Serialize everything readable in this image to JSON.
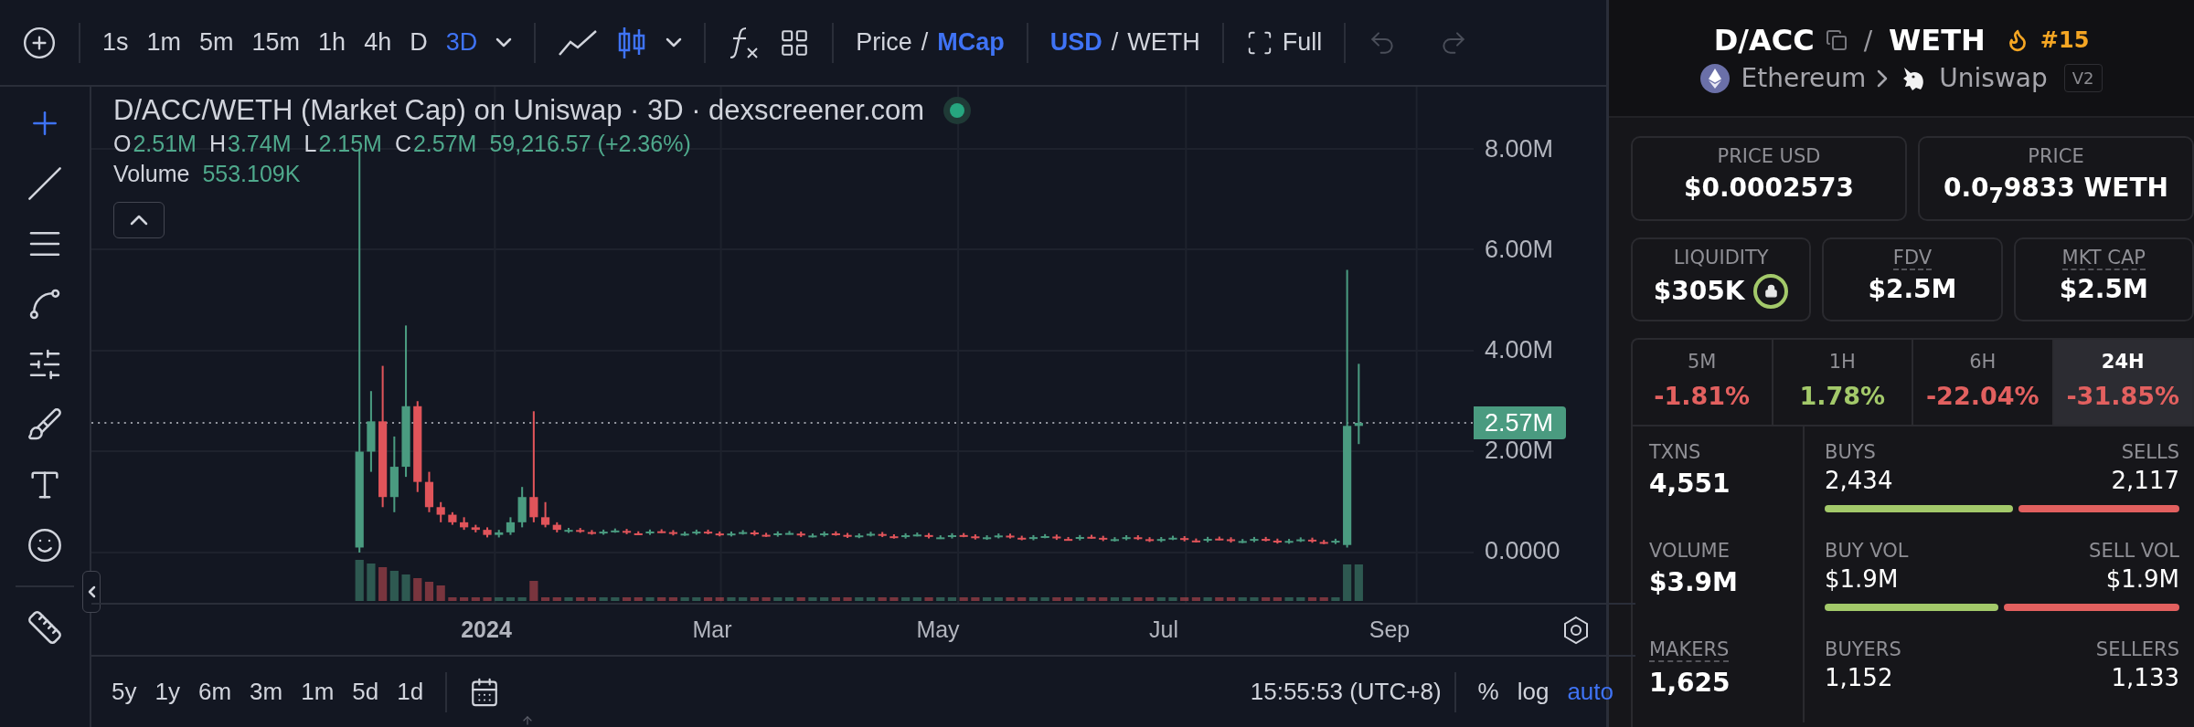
{
  "toolbar": {
    "intervals": [
      {
        "label": "1s",
        "selected": false
      },
      {
        "label": "1m",
        "selected": false
      },
      {
        "label": "5m",
        "selected": false
      },
      {
        "label": "15m",
        "selected": false
      },
      {
        "label": "1h",
        "selected": false
      },
      {
        "label": "4h",
        "selected": false
      },
      {
        "label": "D",
        "selected": false
      },
      {
        "label": "3D",
        "selected": true
      }
    ],
    "chart_types": [
      {
        "kind": "line",
        "selected": false
      },
      {
        "kind": "candles",
        "selected": true
      }
    ],
    "price_mode": {
      "divider": "/",
      "options": [
        {
          "label": "Price",
          "selected": false
        },
        {
          "label": "MCap",
          "selected": true
        }
      ]
    },
    "currency": {
      "divider": "/",
      "options": [
        {
          "label": "USD",
          "selected": true
        },
        {
          "label": "WETH",
          "selected": false
        }
      ]
    },
    "fullscreen_label": "Full",
    "undo_disabled": true,
    "redo_disabled": true
  },
  "drawing_tools": [
    {
      "kind": "crosshair",
      "selected": true
    },
    {
      "kind": "trend-line",
      "selected": false
    },
    {
      "kind": "fib",
      "selected": false
    },
    {
      "kind": "pattern",
      "selected": false
    },
    {
      "kind": "position",
      "selected": false
    },
    {
      "kind": "brush",
      "selected": false
    },
    {
      "kind": "text",
      "selected": false
    },
    {
      "kind": "emoji",
      "selected": false
    },
    {
      "kind": "ruler",
      "selected": false
    }
  ],
  "chart": {
    "title": "D/ACC/WETH (Market Cap) on Uniswap · 3D · dexscreener.com",
    "ohlc": [
      {
        "key": "O",
        "value": "2.51M"
      },
      {
        "key": "H",
        "value": "3.74M"
      },
      {
        "key": "L",
        "value": "2.15M"
      },
      {
        "key": "C",
        "value": "2.57M"
      }
    ],
    "change": "59,216.57 (+2.36%)",
    "volume_label": "Volume",
    "volume_value": "553.109K",
    "y_axis": [
      "8.00M",
      "6.00M",
      "4.00M",
      "2.00M",
      "0.0000"
    ],
    "last_price": "2.57M",
    "x_axis": [
      {
        "label": "2024",
        "year": true
      },
      {
        "label": "Mar",
        "year": false
      },
      {
        "label": "May",
        "year": false
      },
      {
        "label": "Jul",
        "year": false
      },
      {
        "label": "Sep",
        "year": false
      }
    ]
  },
  "bottom_bar": {
    "ranges": [
      "5y",
      "1y",
      "6m",
      "3m",
      "1m",
      "5d",
      "1d"
    ],
    "time": "15:55:53 (UTC+8)",
    "scale_options": [
      {
        "label": "%",
        "selected": false
      },
      {
        "label": "log",
        "selected": false
      },
      {
        "label": "auto",
        "selected": true
      }
    ]
  },
  "pair": {
    "base": "D/ACC",
    "divider": "/",
    "quote": "WETH",
    "rank": "#15",
    "chain": "Ethereum",
    "dex": "Uniswap",
    "version": "V2"
  },
  "price_cards": [
    {
      "label": "PRICE USD",
      "value": "$0.0002573"
    },
    {
      "label": "PRICE",
      "value": "0.0$_{7}$9833 WETH"
    }
  ],
  "metric_cards": [
    {
      "label": "LIQUIDITY",
      "value": "$305K",
      "locked": true,
      "dotted": false
    },
    {
      "label": "FDV",
      "value": "$2.5M",
      "locked": false,
      "dotted": true
    },
    {
      "label": "MKT CAP",
      "value": "$2.5M",
      "locked": false,
      "dotted": true
    }
  ],
  "periods": [
    {
      "label": "5M",
      "change": "-1.81%",
      "color": "#e2605f",
      "selected": false
    },
    {
      "label": "1H",
      "change": "1.78%",
      "color": "#a3c96a",
      "selected": false
    },
    {
      "label": "6H",
      "change": "-22.04%",
      "color": "#e2605f",
      "selected": false
    },
    {
      "label": "24H",
      "change": "-31.85%",
      "color": "#e2605f",
      "selected": true
    }
  ],
  "stats": [
    {
      "label": "TXNS",
      "value": "4,551",
      "dotted": false,
      "buy_label": "BUYS",
      "buy_value": "2,434",
      "sell_label": "SELLS",
      "sell_value": "2,117",
      "level": 0.53
    },
    {
      "label": "VOLUME",
      "value": "$3.9M",
      "dotted": false,
      "buy_label": "BUY VOL",
      "buy_value": "$1.9M",
      "sell_label": "SELL VOL",
      "sell_value": "$1.9M",
      "level": 0.49
    },
    {
      "label": "MAKERS",
      "value": "1,625",
      "dotted": true,
      "buy_label": "BUYERS",
      "buy_value": "1,152",
      "sell_label": "SELLERS",
      "sell_value": "1,133"
    }
  ]
}
